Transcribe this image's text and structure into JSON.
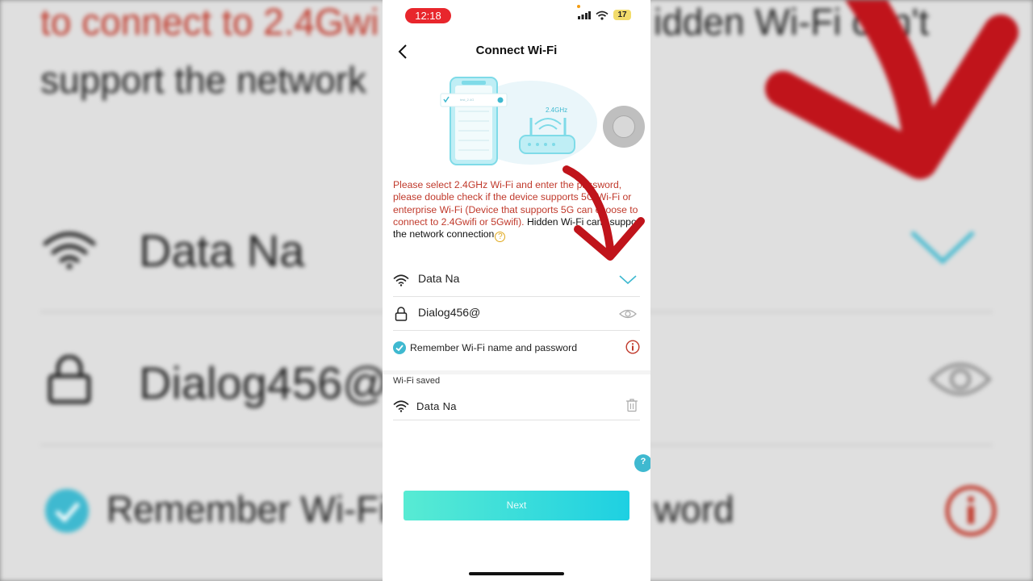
{
  "status_bar": {
    "time": "12:18",
    "battery": "17"
  },
  "header": {
    "title": "Connect Wi-Fi",
    "back_icon": "chevron-left-icon"
  },
  "illustration": {
    "frequency_label": "2.4GHz",
    "wifi_list_item": "test_2.4G"
  },
  "notice": {
    "red_text": "Please select 2.4GHz Wi-Fi and enter the password, please double check if the device supports 5G Wi-Fi or enterprise Wi-Fi (Device that supports 5G can choose to connect to 2.4Gwifi or 5Gwifi).",
    "black_text": " Hidden Wi-Fi can't support the network connection"
  },
  "wifi_field": {
    "value": "Data Na"
  },
  "password_field": {
    "value": "Dialog456@"
  },
  "remember": {
    "label": "Remember Wi-Fi name and password",
    "checked": true
  },
  "saved": {
    "label": "Wi-Fi saved",
    "items": [
      {
        "name": "Data Na"
      }
    ]
  },
  "next_button": {
    "label": "Next"
  },
  "background": {
    "line1_red": "to connect to 2.4Gwi",
    "line1_right": "idden Wi-Fi can't",
    "line2": "support the network",
    "wifi": "Data Na",
    "password": "Dialog456@",
    "remember": "Remember Wi-Fi",
    "remember_tail": "word"
  },
  "colors": {
    "accent": "#3fb9d0",
    "error": "#c0392b",
    "button_start": "#58ebd3",
    "button_end": "#1ed0e2"
  }
}
